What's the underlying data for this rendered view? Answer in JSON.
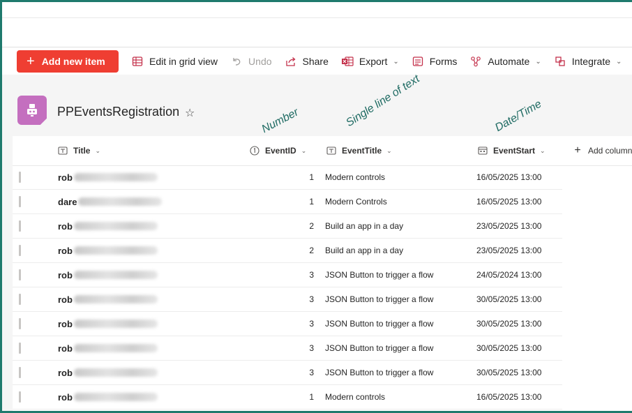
{
  "commandbar": {
    "add_label": "Add new item",
    "edit_grid_label": "Edit in grid view",
    "undo_label": "Undo",
    "share_label": "Share",
    "export_label": "Export",
    "forms_label": "Forms",
    "automate_label": "Automate",
    "integrate_label": "Integrate"
  },
  "list": {
    "title": "PPEventsRegistration"
  },
  "annotations": {
    "number": "Number",
    "single_line": "Single line of text",
    "datetime": "Date/Time"
  },
  "columns": {
    "title": "Title",
    "event_id": "EventID",
    "event_title": "EventTitle",
    "event_start": "EventStart",
    "add_column": "Add column"
  },
  "rows": [
    {
      "title": "rob",
      "event_id": "1",
      "event_title": "Modern controls",
      "event_start": "16/05/2025 13:00"
    },
    {
      "title": "dare",
      "event_id": "1",
      "event_title": "Modern Controls",
      "event_start": "16/05/2025 13:00"
    },
    {
      "title": "rob",
      "event_id": "2",
      "event_title": "Build an app in a day",
      "event_start": "23/05/2025 13:00"
    },
    {
      "title": "rob",
      "event_id": "2",
      "event_title": "Build an app in a day",
      "event_start": "23/05/2025 13:00"
    },
    {
      "title": "rob",
      "event_id": "3",
      "event_title": "JSON Button to trigger a flow",
      "event_start": "24/05/2024 13:00"
    },
    {
      "title": "rob",
      "event_id": "3",
      "event_title": "JSON Button to trigger a flow",
      "event_start": "30/05/2025 13:00"
    },
    {
      "title": "rob",
      "event_id": "3",
      "event_title": "JSON Button to trigger a flow",
      "event_start": "30/05/2025 13:00"
    },
    {
      "title": "rob",
      "event_id": "3",
      "event_title": "JSON Button to trigger a flow",
      "event_start": "30/05/2025 13:00"
    },
    {
      "title": "rob",
      "event_id": "3",
      "event_title": "JSON Button to trigger a flow",
      "event_start": "30/05/2025 13:00"
    },
    {
      "title": "rob",
      "event_id": "1",
      "event_title": "Modern controls",
      "event_start": "16/05/2025 13:00"
    }
  ],
  "colors": {
    "accent": "#ef3e32",
    "frame": "#1f7a6d",
    "site_logo": "#c46fbf",
    "annotation": "#1f6b63"
  },
  "icons": [
    "plus-icon",
    "grid-icon",
    "undo-icon",
    "share-icon",
    "excel-icon",
    "forms-icon",
    "automate-icon",
    "integrate-icon",
    "star-icon",
    "chevron-down-icon",
    "title-column-icon",
    "number-column-icon",
    "text-column-icon",
    "calendar-column-icon"
  ]
}
